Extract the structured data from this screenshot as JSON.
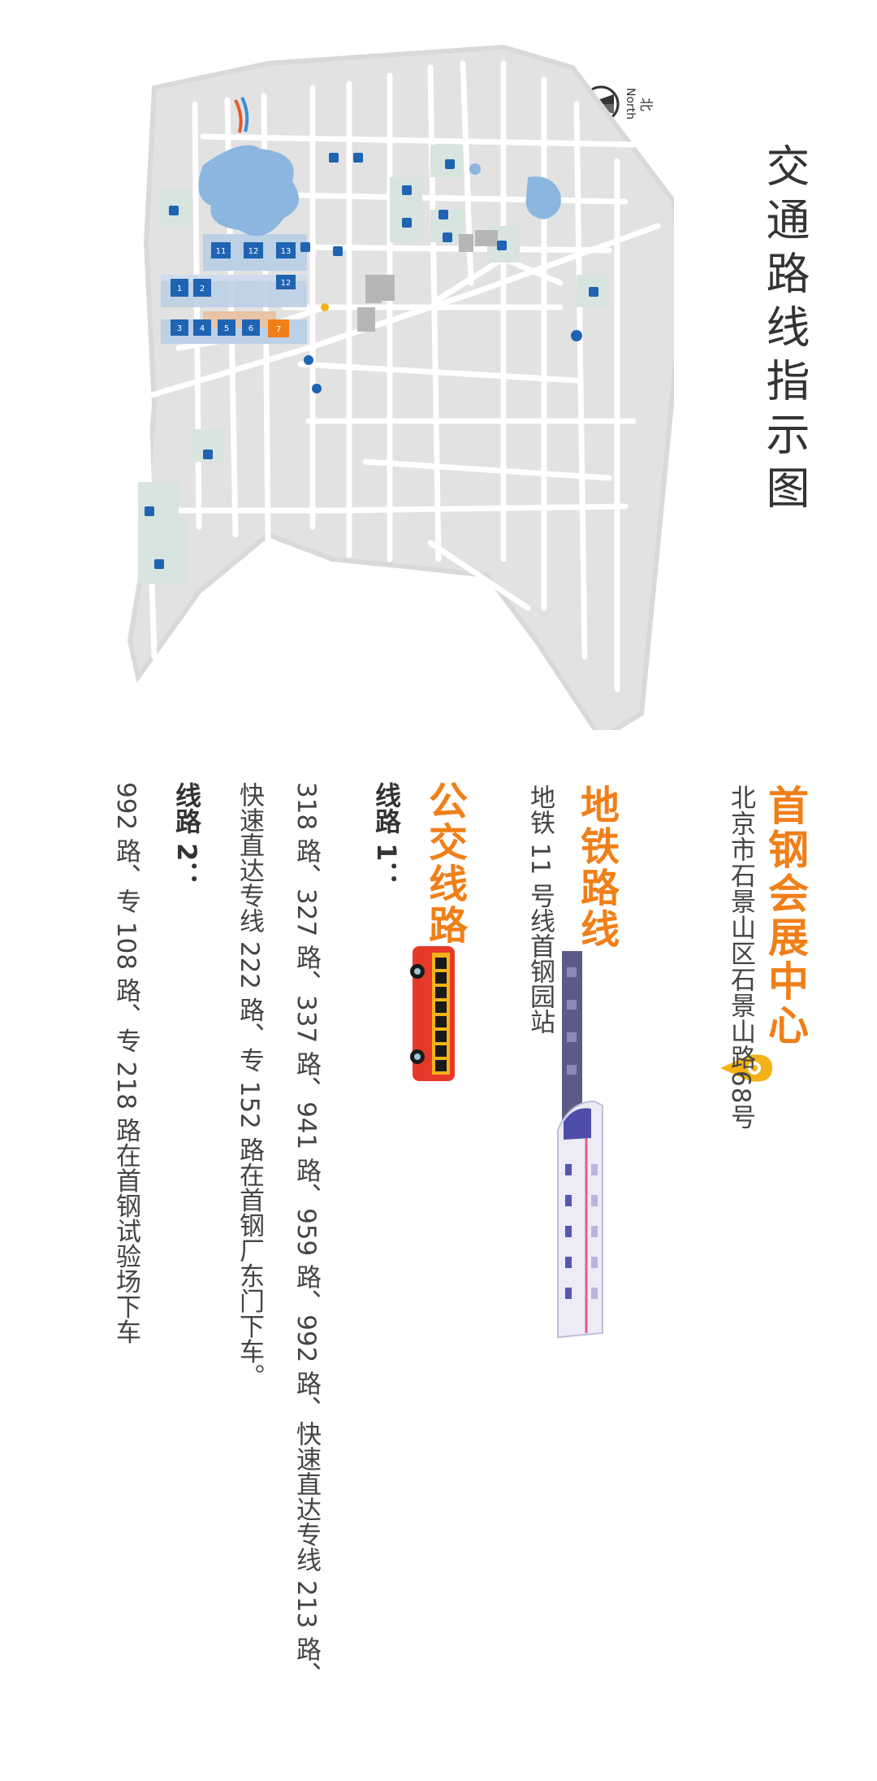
{
  "title": "交通路线指示图",
  "compass": {
    "cn": "北",
    "en": "North"
  },
  "venue": {
    "name": "首钢会展中心",
    "address": "北京市石景山区石景山路68号"
  },
  "subway": {
    "heading": "地铁路线",
    "text": "地铁 11 号线首钢园站"
  },
  "bus": {
    "heading": "公交线路",
    "route1_label": "线路 1：",
    "route1_line1": "318 路、327 路、337 路、941 路、959 路、992 路、快速直达专线 213 路、",
    "route1_line2": "快速直达专线 222 路、专 152 路在首钢厂东门下车。",
    "route2_label": "线路 2：",
    "route2_text": "992 路、专 108 路、专 218 路在首钢试验场下车"
  },
  "map": {
    "hall_numbers": [
      "1",
      "2",
      "3",
      "4",
      "5",
      "6",
      "7",
      "11",
      "12",
      "13",
      "12"
    ]
  },
  "colors": {
    "accent": "#f07f18",
    "parking_blue": "#1f63b3",
    "water": "#8bb6df",
    "green_area": "#d7e4df",
    "road": "#ffffff",
    "ground": "#e2e2e2"
  }
}
